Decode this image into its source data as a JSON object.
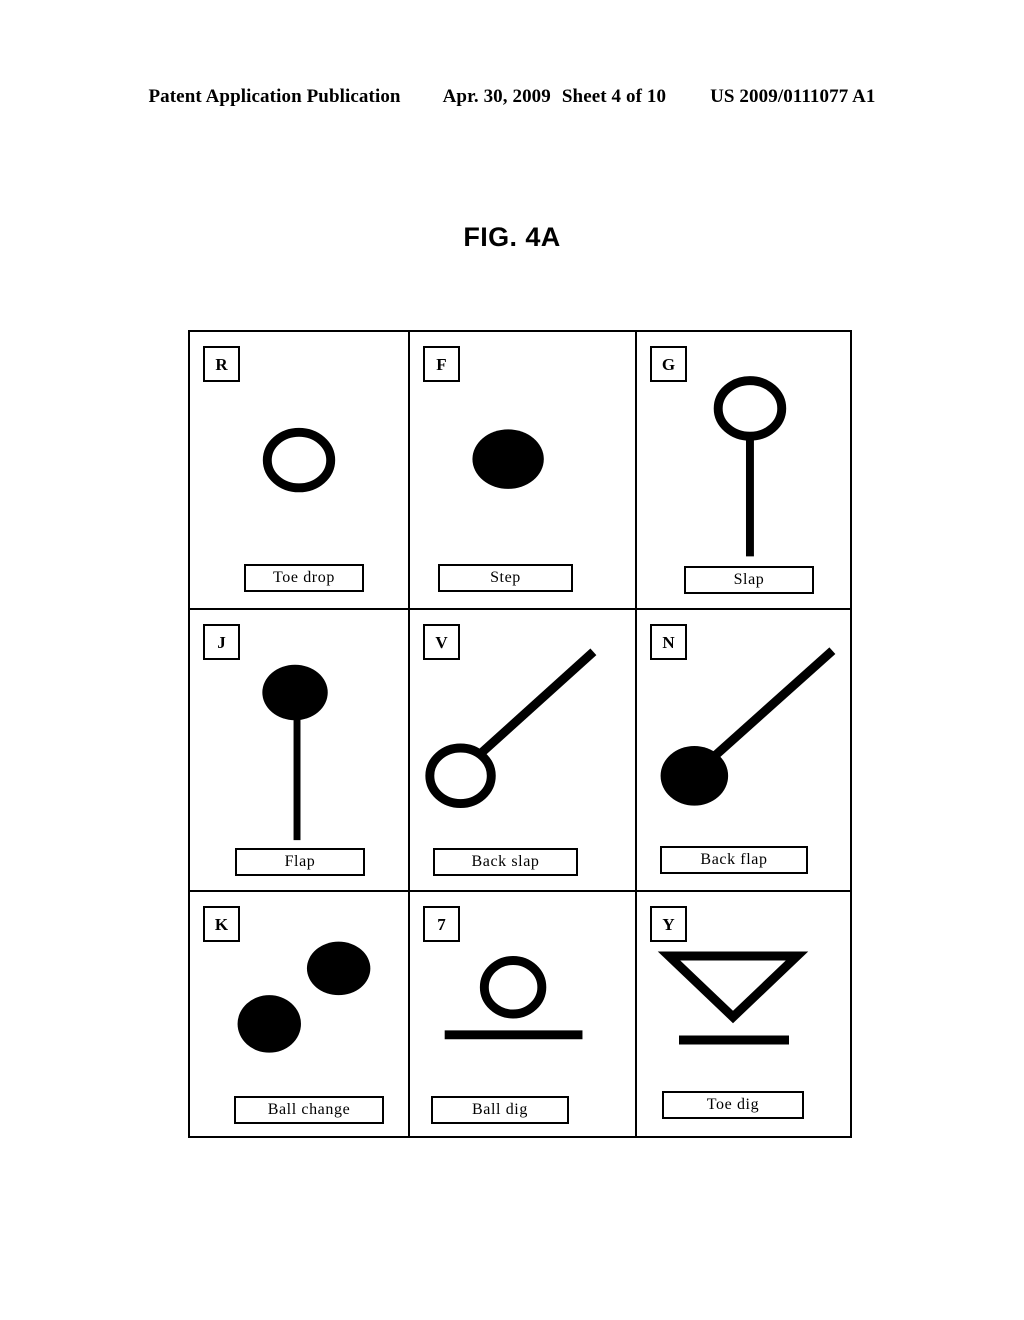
{
  "header": {
    "publication": "Patent Application Publication",
    "date": "Apr. 30, 2009",
    "sheet": "Sheet 4 of 10",
    "number": "US 2009/0111077 A1"
  },
  "figure": {
    "title": "FIG. 4A"
  },
  "colors": {
    "ink": "#000000",
    "paper": "#ffffff"
  },
  "chart_data": {
    "type": "table",
    "title": "FIG. 4A",
    "description": "Dance notation symbol legend grid: 3 columns x 3 rows of symbol cells, each with a keyboard key letter, a glyph drawing, and a movement name label.",
    "columns": 3,
    "rows": 3,
    "cells": [
      {
        "key": "R",
        "label": "Toe drop",
        "glyph": "hollow-circle"
      },
      {
        "key": "F",
        "label": "Step",
        "glyph": "filled-circle"
      },
      {
        "key": "G",
        "label": "Slap",
        "glyph": "hollow-circle-with-vertical-stem"
      },
      {
        "key": "J",
        "label": "Flap",
        "glyph": "filled-circle-with-vertical-stem"
      },
      {
        "key": "V",
        "label": "Back slap",
        "glyph": "hollow-circle-with-diagonal-stem"
      },
      {
        "key": "N",
        "label": "Back flap",
        "glyph": "filled-circle-with-diagonal-stem"
      },
      {
        "key": "K",
        "label": "Ball change",
        "glyph": "two-filled-circles-diagonal"
      },
      {
        "key": "7",
        "label": "Ball dig",
        "glyph": "hollow-circle-over-horizontal-bar"
      },
      {
        "key": "Y",
        "label": "Toe dig",
        "glyph": "down-triangle-over-horizontal-bar"
      }
    ]
  },
  "grid": {
    "cells": [
      {
        "key": "R",
        "label": "Toe drop"
      },
      {
        "key": "F",
        "label": "Step"
      },
      {
        "key": "G",
        "label": "Slap"
      },
      {
        "key": "J",
        "label": "Flap"
      },
      {
        "key": "V",
        "label": "Back slap"
      },
      {
        "key": "N",
        "label": "Back flap"
      },
      {
        "key": "K",
        "label": "Ball change"
      },
      {
        "key": "7",
        "label": "Ball dig"
      },
      {
        "key": "Y",
        "label": "Toe dig"
      }
    ]
  }
}
